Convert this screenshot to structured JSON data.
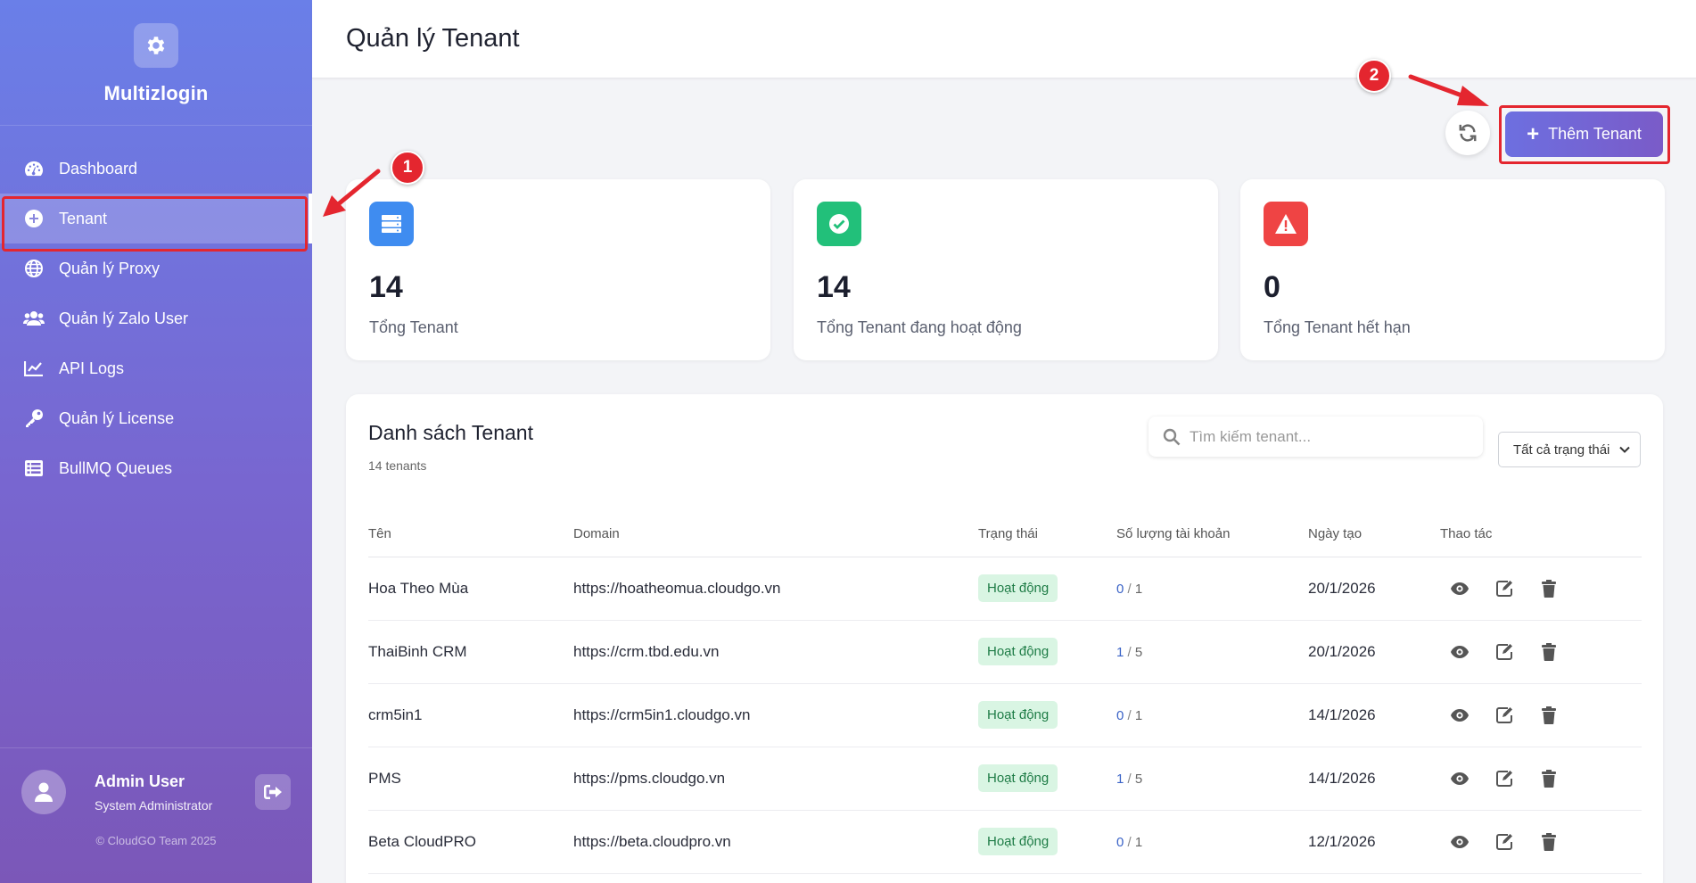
{
  "sidebar": {
    "brand": "Multizlogin",
    "items": [
      {
        "label": "Dashboard",
        "icon": "dashboard-icon"
      },
      {
        "label": "Tenant",
        "icon": "plus-circle-icon"
      },
      {
        "label": "Quản lý Proxy",
        "icon": "globe-icon"
      },
      {
        "label": "Quản lý Zalo User",
        "icon": "users-icon"
      },
      {
        "label": "API Logs",
        "icon": "chart-line-icon"
      },
      {
        "label": "Quản lý License",
        "icon": "key-icon"
      },
      {
        "label": "BullMQ Queues",
        "icon": "list-icon"
      }
    ],
    "active_index": 1,
    "user": {
      "name": "Admin User",
      "role": "System Administrator"
    },
    "copyright": "© CloudGO Team 2025"
  },
  "header": {
    "title": "Quản lý Tenant"
  },
  "toolbar": {
    "add_label": "Thêm Tenant"
  },
  "stats": [
    {
      "value": "14",
      "label": "Tổng Tenant",
      "color": "#3f8cf0",
      "icon": "server-icon"
    },
    {
      "value": "14",
      "label": "Tổng Tenant đang hoạt động",
      "color": "#22c07a",
      "icon": "check-circle-icon"
    },
    {
      "value": "0",
      "label": "Tổng Tenant hết hạn",
      "color": "#ef4444",
      "icon": "warning-icon"
    }
  ],
  "list": {
    "title": "Danh sách Tenant",
    "subtitle": "14 tenants",
    "search_placeholder": "Tìm kiếm tenant...",
    "status_filter": "Tất cả trạng thái",
    "columns": [
      "Tên",
      "Domain",
      "Trạng thái",
      "Số lượng tài khoản",
      "Ngày tạo",
      "Thao tác"
    ],
    "rows": [
      {
        "name": "Hoa Theo Mùa",
        "domain": "https://hoatheomua.cloudgo.vn",
        "status": "Hoạt động",
        "used": "0",
        "max": "1",
        "created": "20/1/2026"
      },
      {
        "name": "ThaiBinh CRM",
        "domain": "https://crm.tbd.edu.vn",
        "status": "Hoạt động",
        "used": "1",
        "max": "5",
        "created": "20/1/2026"
      },
      {
        "name": "crm5in1",
        "domain": "https://crm5in1.cloudgo.vn",
        "status": "Hoạt động",
        "used": "0",
        "max": "1",
        "created": "14/1/2026"
      },
      {
        "name": "PMS",
        "domain": "https://pms.cloudgo.vn",
        "status": "Hoạt động",
        "used": "1",
        "max": "5",
        "created": "14/1/2026"
      },
      {
        "name": "Beta CloudPRO",
        "domain": "https://beta.cloudpro.vn",
        "status": "Hoạt động",
        "used": "0",
        "max": "1",
        "created": "12/1/2026"
      }
    ]
  },
  "annotations": {
    "marker_1": "1",
    "marker_2": "2",
    "color": "#e4262f"
  }
}
